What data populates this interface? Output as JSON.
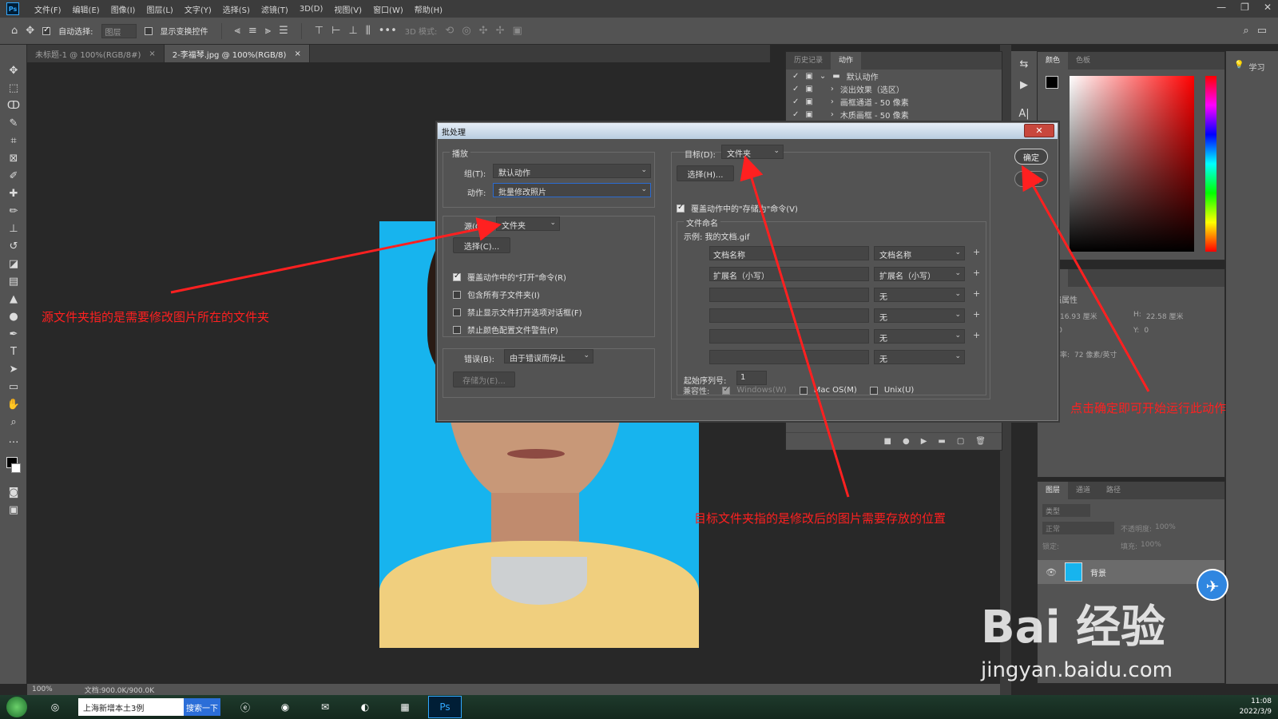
{
  "menubar": {
    "logo": "Ps",
    "items": [
      "文件(F)",
      "编辑(E)",
      "图像(I)",
      "图层(L)",
      "文字(Y)",
      "选择(S)",
      "滤镜(T)",
      "3D(D)",
      "视图(V)",
      "窗口(W)",
      "帮助(H)"
    ],
    "win_controls": [
      "—",
      "❐",
      "✕"
    ]
  },
  "optbar": {
    "auto_select_label": "自动选择:",
    "auto_select_value": "图层",
    "show_transform_label": "显示变换控件",
    "mode_3d_label": "3D 模式:",
    "more": "•••"
  },
  "tabs": [
    {
      "label": "未标题-1 @ 100%(RGB/8#)",
      "close": "×"
    },
    {
      "label": "2-李福琴.jpg @ 100%(RGB/8)",
      "close": "×"
    }
  ],
  "status": {
    "zoom": "100%",
    "doc": "文档:900.0K/900.0K"
  },
  "actions_panel": {
    "tabs": [
      "历史记录",
      "动作"
    ],
    "rows": [
      "默认动作",
      "淡出效果（选区）",
      "画框通道 - 50 像素",
      "木质画框 - 50 像素"
    ],
    "footer": [
      "■",
      "●",
      "▶",
      "▬",
      "▢",
      "🗑"
    ]
  },
  "color_panel": {
    "tabs": [
      "颜色",
      "色板"
    ]
  },
  "props_panel": {
    "tab": "属性",
    "title": "文档属性",
    "w_label": "宽:",
    "w_value": "16.93 厘米",
    "h_label": "H:",
    "h_value": "22.58 厘米",
    "x_label": "X:",
    "x_value": "0",
    "y_label": "Y:",
    "y_value": "0",
    "res_label": "分辨率:",
    "res_value": "72 像素/英寸"
  },
  "learn_panel": {
    "label": "学习"
  },
  "layers_panel": {
    "tabs": [
      "图层",
      "通道",
      "路径"
    ],
    "filter_placeholder": "类型",
    "blend_mode": "正常",
    "opacity_label": "不透明度:",
    "opacity_value": "100%",
    "lock_label": "锁定:",
    "fill_label": "填充:",
    "fill_value": "100%",
    "layer_name": "背景"
  },
  "dialog": {
    "title": "批处理",
    "close": "✕",
    "play_group": "播放",
    "group_label": "组(T):",
    "group_value": "默认动作",
    "action_label": "动作:",
    "action_value": "批量修改照片",
    "source_label": "源(O):",
    "source_value": "文件夹",
    "choose_source": "选择(C)...",
    "source_checks": [
      {
        "label": "覆盖动作中的\"打开\"命令(R)",
        "checked": true
      },
      {
        "label": "包含所有子文件夹(I)",
        "checked": false
      },
      {
        "label": "禁止显示文件打开选项对话框(F)",
        "checked": false
      },
      {
        "label": "禁止颜色配置文件警告(P)",
        "checked": false
      }
    ],
    "error_label": "错误(B):",
    "error_value": "由于错误而停止",
    "save_as": "存储为(E)...",
    "dest_label": "目标(D):",
    "dest_value": "文件夹",
    "choose_dest": "选择(H)...",
    "override_save": "覆盖动作中的\"存储为\"命令(V)",
    "naming_title": "文件命名",
    "example": "示例: 我的文档.gif",
    "naming_rows": [
      {
        "text": "文档名称",
        "select": "文档名称"
      },
      {
        "text": "扩展名（小写）",
        "select": "扩展名（小写）"
      },
      {
        "text": "",
        "select": "无"
      },
      {
        "text": "",
        "select": "无"
      },
      {
        "text": "",
        "select": "无"
      },
      {
        "text": "",
        "select": "无"
      }
    ],
    "serial_label": "起始序列号:",
    "serial_value": "1",
    "compat_label": "兼容性:",
    "compat": [
      "Windows(W)",
      "Mac OS(M)",
      "Unix(U)"
    ],
    "ok": "确定",
    "reset": "复位"
  },
  "annotations": {
    "source": "源文件夹指的是需要修改图片所在的文件夹",
    "target": "目标文件夹指的是修改后的图片需要存放的位置",
    "ok": "点击确定即可开始运行此动作"
  },
  "watermark": {
    "big": "Bai 经验",
    "small": "jingyan.baidu.com"
  },
  "taskbar": {
    "ie_text": "上海新增本土3例",
    "search_btn": "搜索一下",
    "ps": "Ps",
    "time": "11:08",
    "date": "2022/3/9"
  },
  "colors": {
    "accent_red": "#ff2020",
    "photo_bg": "#17b4ee",
    "ps_blue": "#31a8ff"
  }
}
